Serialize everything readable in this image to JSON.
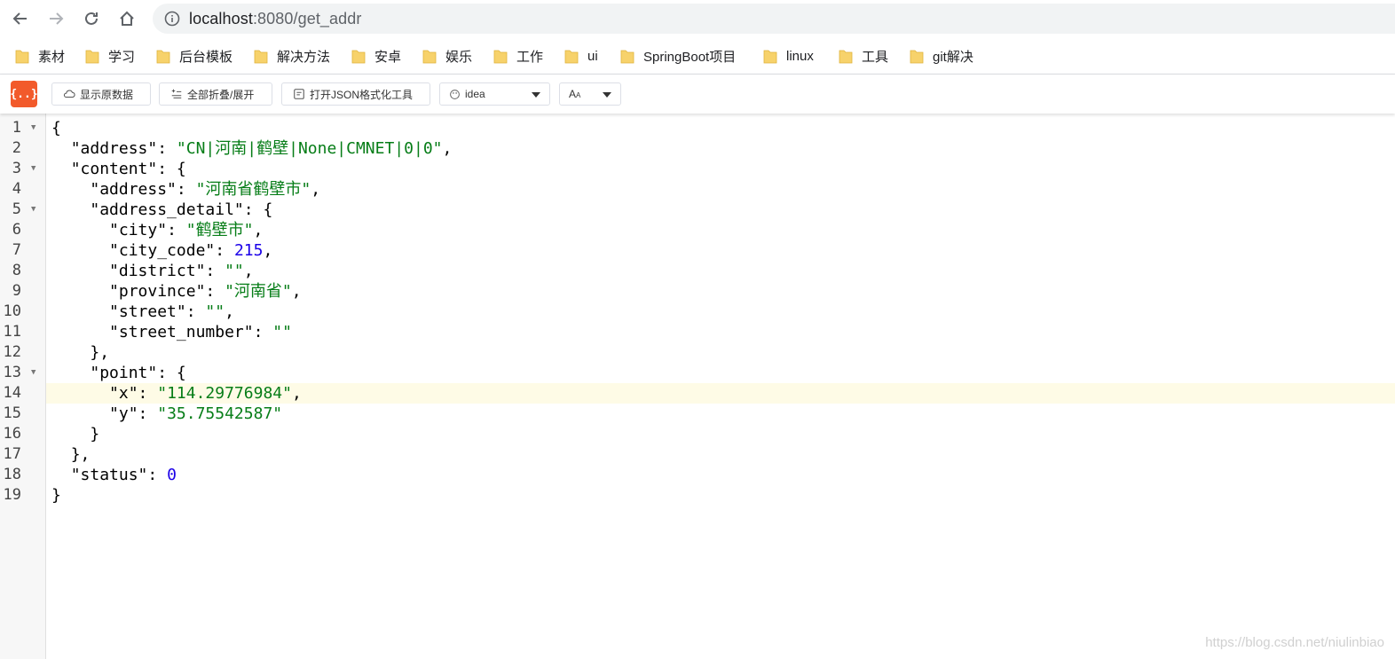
{
  "browser": {
    "url_host": "localhost",
    "url_path": ":8080/get_addr"
  },
  "bookmarks": [
    "素材",
    "学习",
    "后台模板",
    "解决方法",
    "安卓",
    "娱乐",
    "工作",
    "ui",
    "SpringBoot项目",
    "linux",
    "工具",
    "git解决"
  ],
  "toolbar": {
    "logo": "{..}",
    "raw_button": "显示原数据",
    "fold_button": "全部折叠/展开",
    "format_button": "打开JSON格式化工具",
    "theme_value": "idea",
    "font_value": "A"
  },
  "json_lines": [
    {
      "n": "1",
      "html": "{",
      "fold": true
    },
    {
      "n": "2",
      "indent": 1,
      "key": "address",
      "str": "CN|河南|鹤壁|None|CMNET|0|0",
      "comma": true
    },
    {
      "n": "3",
      "indent": 1,
      "key": "content",
      "open": "{",
      "fold": true
    },
    {
      "n": "4",
      "indent": 2,
      "key": "address",
      "str": "河南省鹤壁市",
      "comma": true
    },
    {
      "n": "5",
      "indent": 2,
      "key": "address_detail",
      "open": "{",
      "fold": true
    },
    {
      "n": "6",
      "indent": 3,
      "key": "city",
      "str": "鹤壁市",
      "comma": true
    },
    {
      "n": "7",
      "indent": 3,
      "key": "city_code",
      "num": "215",
      "comma": true
    },
    {
      "n": "8",
      "indent": 3,
      "key": "district",
      "str": "",
      "comma": true
    },
    {
      "n": "9",
      "indent": 3,
      "key": "province",
      "str": "河南省",
      "comma": true
    },
    {
      "n": "10",
      "indent": 3,
      "key": "street",
      "str": "",
      "comma": true
    },
    {
      "n": "11",
      "indent": 3,
      "key": "street_number",
      "str": "",
      "comma": false
    },
    {
      "n": "12",
      "indent": 2,
      "close": "},"
    },
    {
      "n": "13",
      "indent": 2,
      "key": "point",
      "open": "{",
      "fold": true
    },
    {
      "n": "14",
      "indent": 3,
      "key": "x",
      "str": "114.29776984",
      "comma": true,
      "active": true
    },
    {
      "n": "15",
      "indent": 3,
      "key": "y",
      "str": "35.75542587",
      "comma": false
    },
    {
      "n": "16",
      "indent": 2,
      "close": "}"
    },
    {
      "n": "17",
      "indent": 1,
      "close": "},"
    },
    {
      "n": "18",
      "indent": 1,
      "key": "status",
      "num": "0",
      "comma": false
    },
    {
      "n": "19",
      "html": "}"
    }
  ],
  "watermark": "https://blog.csdn.net/niulinbiao",
  "colors": {
    "key": "#000000",
    "string": "#067d17",
    "number": "#1b00e8",
    "logo": "#f25a2b"
  }
}
